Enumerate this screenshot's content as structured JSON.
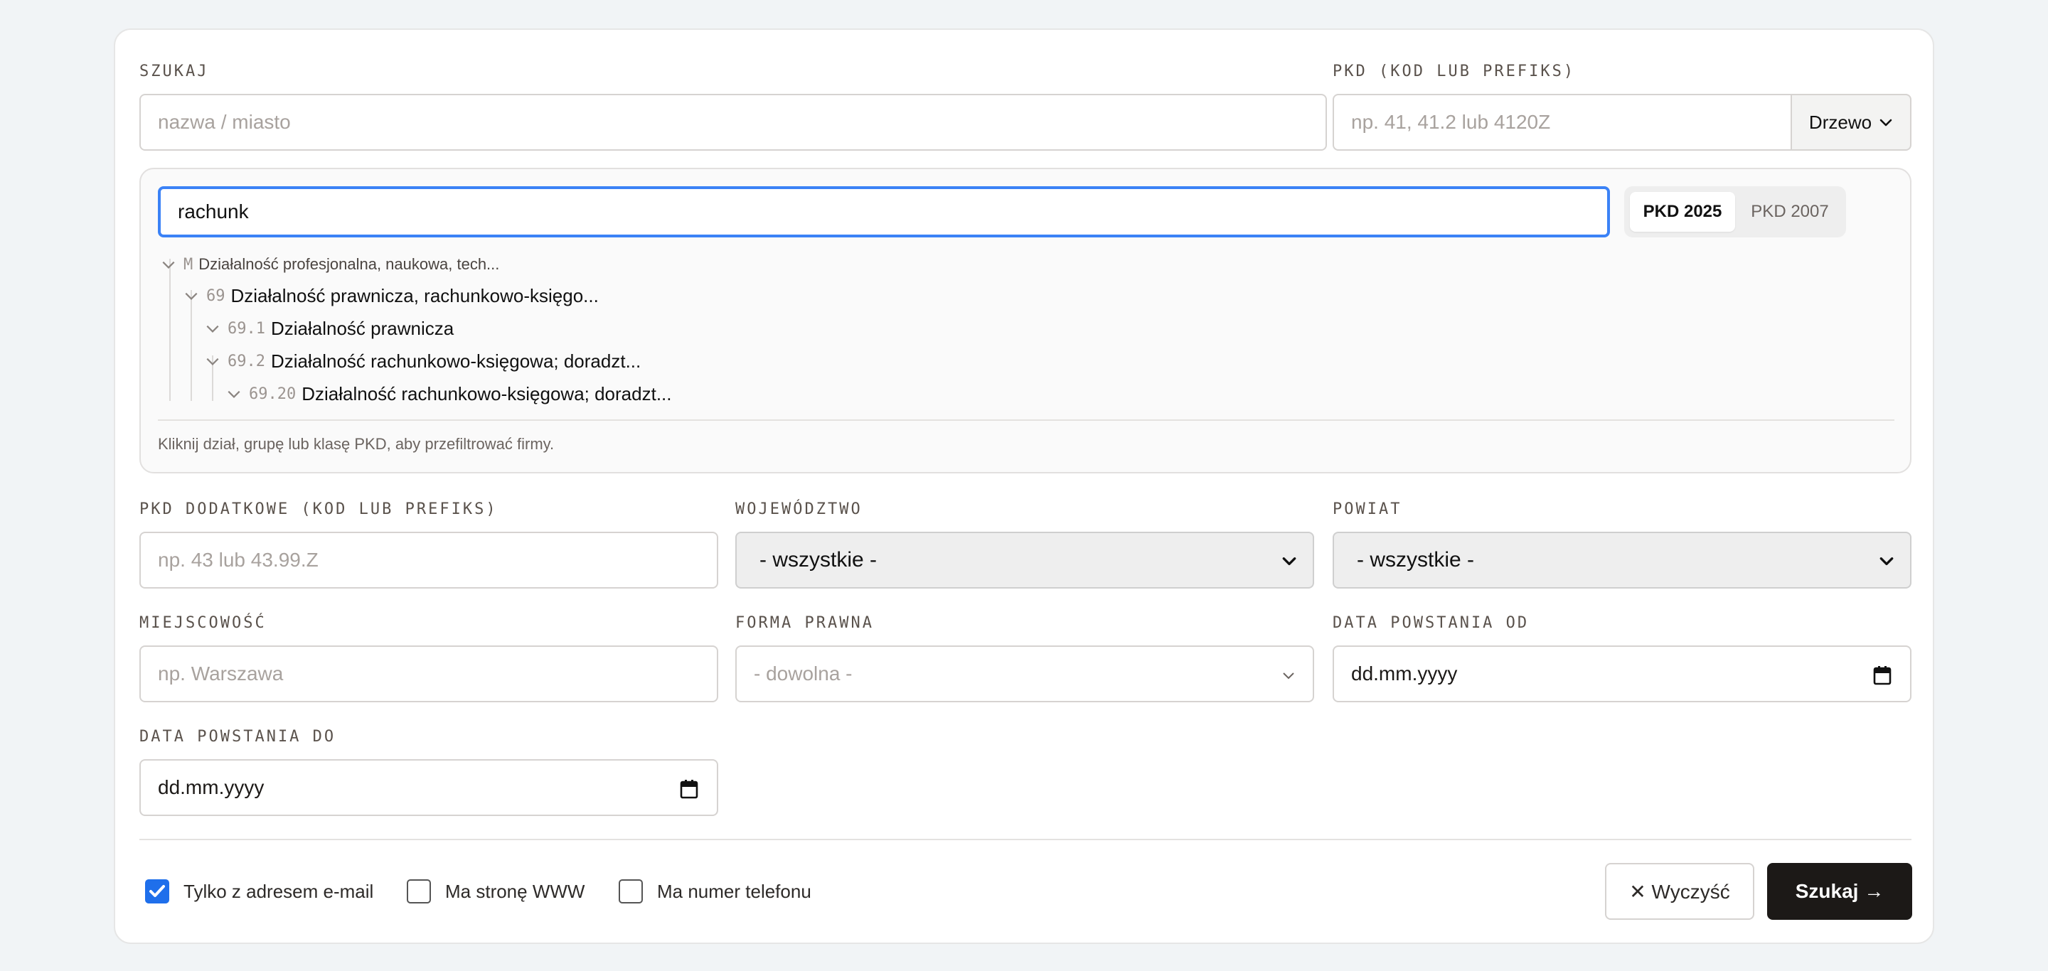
{
  "search": {
    "label": "SZUKAJ",
    "placeholder": "nazwa / miasto"
  },
  "pkd": {
    "label": "PKD (KOD LUB PREFIKS)",
    "placeholder": "np. 41, 41.2 lub 4120Z",
    "mode_button": "Drzewo"
  },
  "tree": {
    "query": "rachunk",
    "versions": [
      "PKD 2025",
      "PKD 2007"
    ],
    "active_version": "PKD 2025",
    "nodes": [
      {
        "code": "M",
        "name": "Działalność profesjonalna, naukowa, tech..."
      },
      {
        "code": "69",
        "name": "Działalność prawnicza, rachunkowo-księgo..."
      },
      {
        "code": "69.1",
        "name": "Działalność prawnicza"
      },
      {
        "code": "69.2",
        "name": "Działalność rachunkowo-księgowa; doradzt..."
      },
      {
        "code": "69.20",
        "name": "Działalność rachunkowo-księgowa; doradzt..."
      }
    ],
    "hint": "Kliknij dział, grupę lub klasę PKD, aby przefiltrować firmy."
  },
  "pkd_extra": {
    "label": "PKD DODATKOWE (KOD LUB PREFIKS)",
    "placeholder": "np. 43 lub 43.99.Z"
  },
  "voivodeship": {
    "label": "WOJEWÓDZTWO",
    "value": "- wszystkie -"
  },
  "county": {
    "label": "POWIAT",
    "value": "- wszystkie -"
  },
  "city": {
    "label": "MIEJSCOWOŚĆ",
    "placeholder": "np. Warszawa"
  },
  "legal_form": {
    "label": "FORMA PRAWNA",
    "value": "- dowolna -"
  },
  "date_from": {
    "label": "DATA POWSTANIA OD",
    "value": "dd.mm.yyyy"
  },
  "date_to": {
    "label": "DATA POWSTANIA DO",
    "value": "dd.mm.yyyy"
  },
  "filters": [
    {
      "label": "Tylko z adresem e-mail",
      "checked": true
    },
    {
      "label": "Ma stronę WWW",
      "checked": false
    },
    {
      "label": "Ma numer telefonu",
      "checked": false
    }
  ],
  "actions": {
    "clear": "✕ Wyczyść",
    "submit": "Szukaj →"
  },
  "colors": {
    "accent": "#3b82f6",
    "checkbox": "#1f6feb",
    "primary_button": "#1c1917"
  }
}
